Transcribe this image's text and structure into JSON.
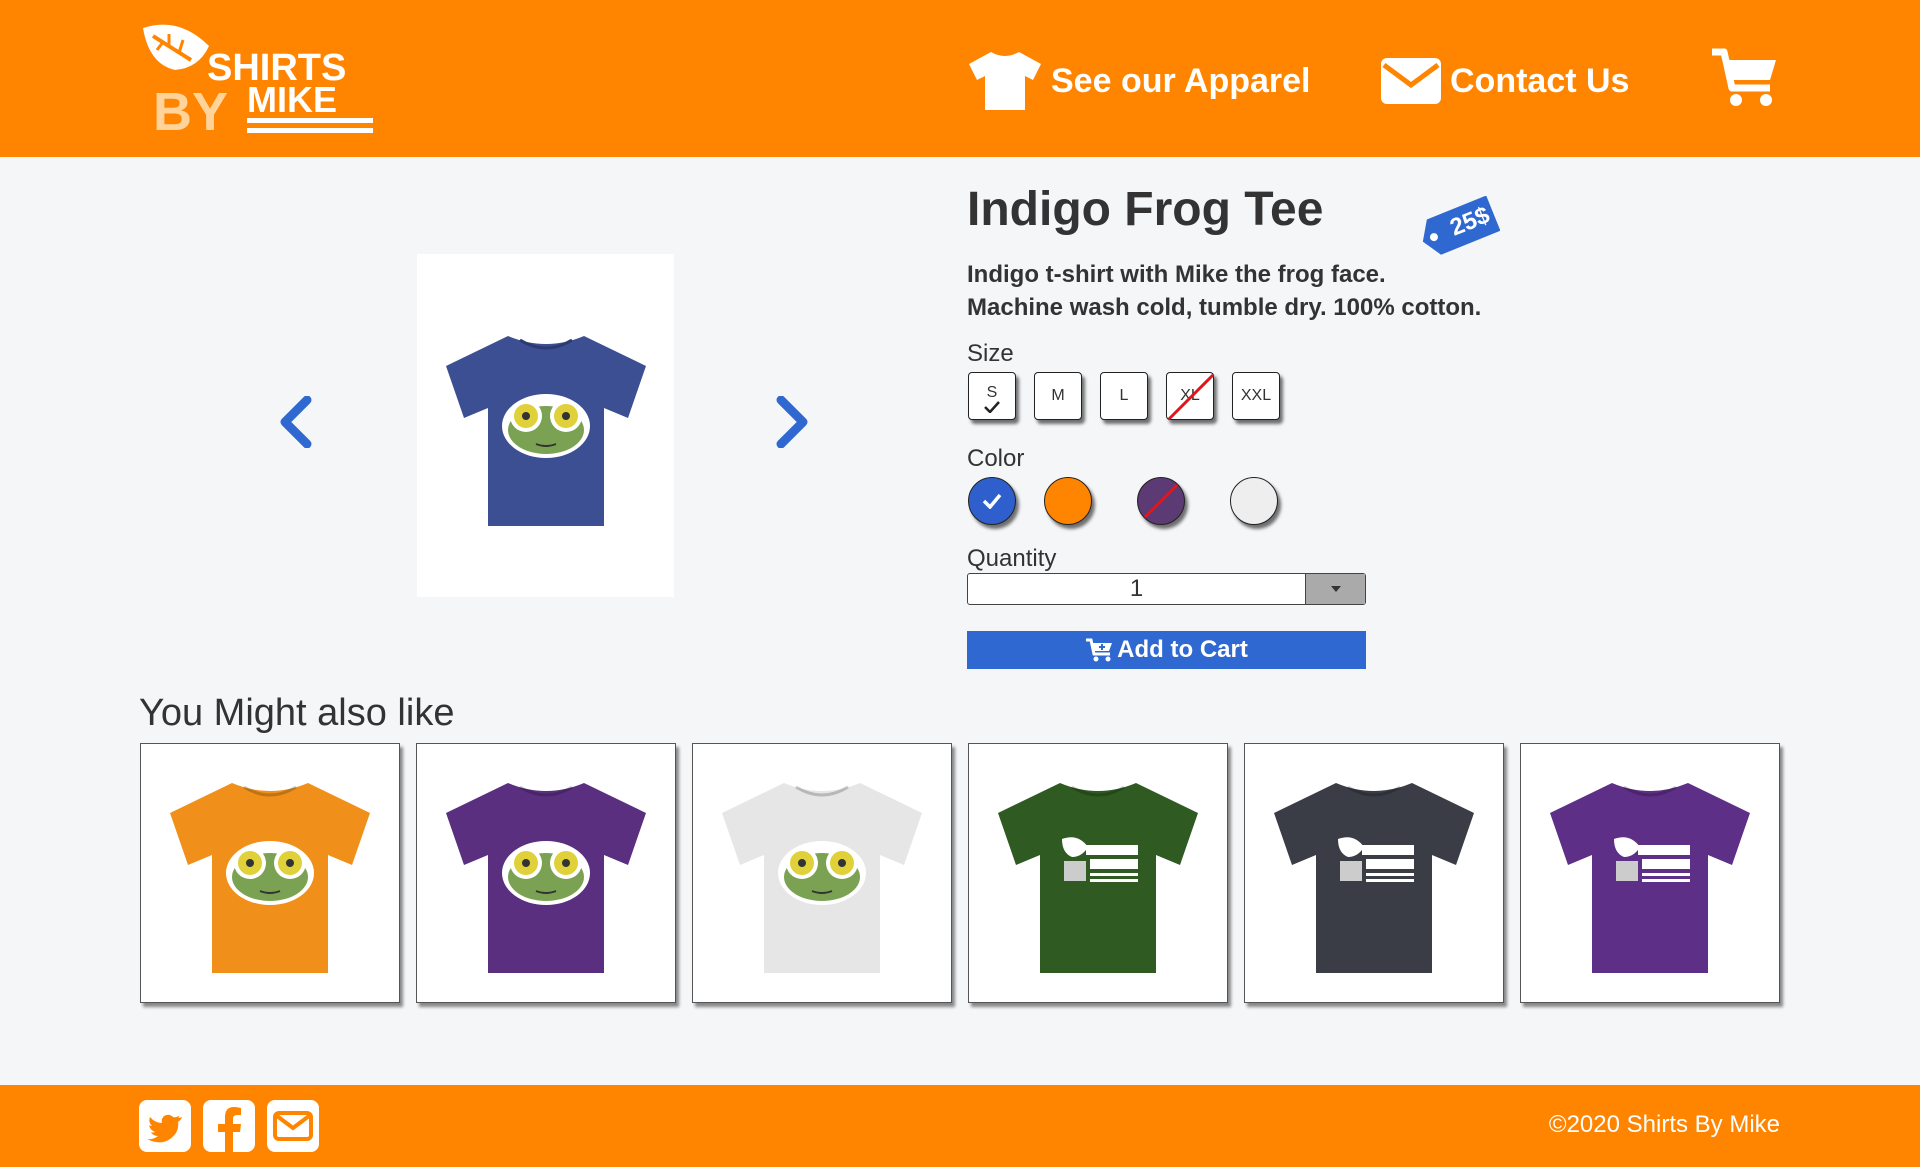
{
  "header": {
    "logo_alt": "Shirts By Mike",
    "nav": [
      {
        "label": "See our Apparel",
        "icon": "tshirt-icon"
      },
      {
        "label": "Contact Us",
        "icon": "envelope-icon"
      }
    ],
    "cart_icon": "shopping-cart-icon"
  },
  "product": {
    "title": "Indigo Frog Tee",
    "price": "25$",
    "description_line1": "Indigo t-shirt with Mike the frog face.",
    "description_line2": "Machine wash cold, tumble dry. 100% cotton.",
    "image_color": "#3d4f93"
  },
  "options": {
    "size_label": "Size",
    "sizes": [
      {
        "label": "S",
        "selected": true,
        "available": true
      },
      {
        "label": "M",
        "selected": false,
        "available": true
      },
      {
        "label": "L",
        "selected": false,
        "available": true
      },
      {
        "label": "XL",
        "selected": false,
        "available": false
      },
      {
        "label": "XXL",
        "selected": false,
        "available": true
      }
    ],
    "color_label": "Color",
    "colors": [
      {
        "name": "indigo",
        "hex": "#2f5fcc",
        "selected": true,
        "available": true
      },
      {
        "name": "orange",
        "hex": "#ff8400",
        "selected": false,
        "available": true
      },
      {
        "name": "purple",
        "hex": "#5c3a74",
        "selected": false,
        "available": false
      },
      {
        "name": "white",
        "hex": "#eeeeee",
        "selected": false,
        "available": true
      }
    ],
    "quantity_label": "Quantity",
    "quantity_value": "1"
  },
  "add_to_cart_label": "Add to Cart",
  "related": {
    "heading": "You Might also like",
    "items": [
      {
        "color": "#f0901a",
        "design": "frog"
      },
      {
        "color": "#5b2f80",
        "design": "frog"
      },
      {
        "color": "#e6e6e6",
        "design": "frog"
      },
      {
        "color": "#2f5a22",
        "design": "logo"
      },
      {
        "color": "#3a3c46",
        "design": "logo"
      },
      {
        "color": "#5e2f86",
        "design": "logo"
      }
    ]
  },
  "footer": {
    "social": [
      "twitter-icon",
      "facebook-icon",
      "mail-icon"
    ],
    "copyright": "©2020 Shirts By Mike"
  },
  "colors": {
    "brand_orange": "#ff8400",
    "accent_blue": "#2f68d0",
    "background": "#f5f6f8"
  }
}
